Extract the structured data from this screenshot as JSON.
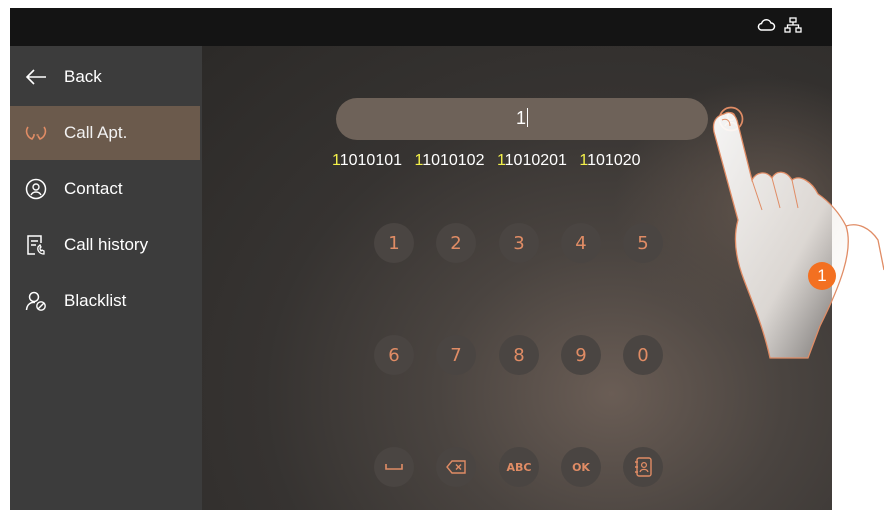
{
  "sidebar": {
    "items": [
      {
        "label": "Back",
        "icon": "back-arrow-icon",
        "active": false
      },
      {
        "label": "Call Apt.",
        "icon": "call-icon",
        "active": true
      },
      {
        "label": "Contact",
        "icon": "contact-icon",
        "active": false
      },
      {
        "label": "Call history",
        "icon": "call-history-icon",
        "active": false
      },
      {
        "label": "Blacklist",
        "icon": "blacklist-icon",
        "active": false
      }
    ]
  },
  "status": {
    "icons": [
      "cloud-icon",
      "network-icon"
    ]
  },
  "input": {
    "value": "1"
  },
  "suggestions": [
    {
      "match": "1",
      "rest": "1010101"
    },
    {
      "match": "1",
      "rest": "1010102"
    },
    {
      "match": "1",
      "rest": "1010201"
    },
    {
      "match": "1",
      "rest": "101020"
    }
  ],
  "keypad": {
    "row1": [
      "1",
      "2",
      "3",
      "4",
      "5"
    ],
    "row2": [
      "6",
      "7",
      "8",
      "9",
      "0"
    ],
    "row3": {
      "space": "space-icon",
      "backspace": "backspace-icon",
      "abc": "ABC",
      "ok": "OK",
      "directory": "directory-icon"
    }
  },
  "callout": {
    "number": "1"
  },
  "colors": {
    "accent": "#e08c65",
    "highlight": "#f4f14a",
    "sidebar_active": "#6b5a4c",
    "callout": "#f37021"
  }
}
